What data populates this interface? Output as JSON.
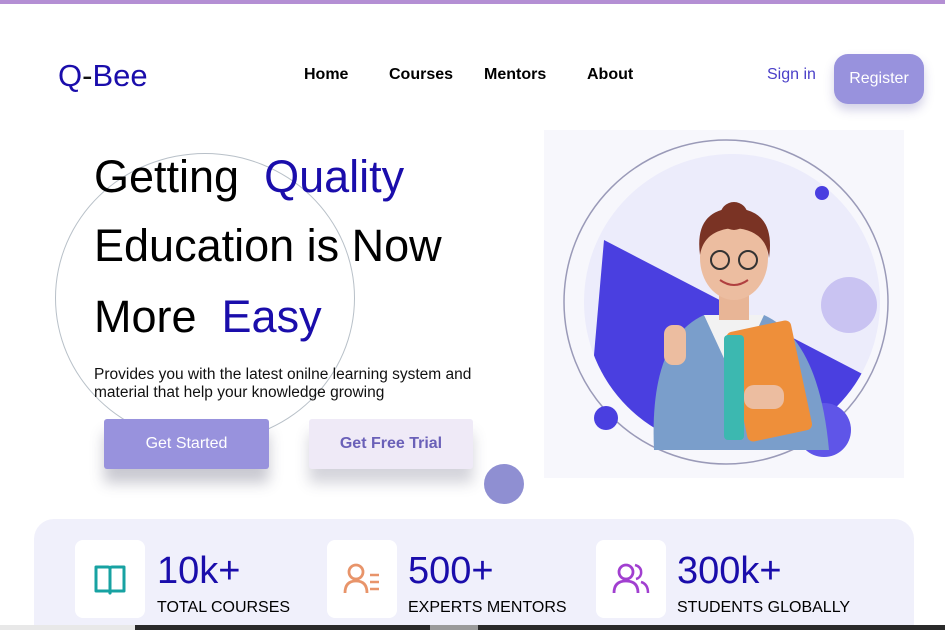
{
  "brand": {
    "name_prefix": "Q",
    "name_dash": "-",
    "name_suffix": "Bee"
  },
  "nav": {
    "home": "Home",
    "courses": "Courses",
    "mentors": "Mentors",
    "about": "About"
  },
  "auth": {
    "signin": "Sign in",
    "register": "Register"
  },
  "hero": {
    "line1_a": "Getting",
    "line1_b": "Quality",
    "line2": "Education is Now",
    "line3_a": "More",
    "line3_b": "Easy",
    "subtext": "Provides you with the latest onilne learning system and material that help your knowledge growing",
    "cta_primary": "Get Started",
    "cta_secondary": "Get Free Trial"
  },
  "stats": [
    {
      "icon": "book-icon",
      "value": "10k+",
      "label": "TOTAL COURSES",
      "color": "#17a2a2"
    },
    {
      "icon": "mentor-list-icon",
      "value": "500+",
      "label": "EXPERTS MENTORS",
      "color": "#e8946a"
    },
    {
      "icon": "users-icon",
      "value": "300k+",
      "label": "STUDENTS GLOBALLY",
      "color": "#a13fd0"
    }
  ],
  "colors": {
    "accent": "#1a0dab",
    "button": "#9892dd",
    "topbar": "#b48fd4",
    "hero_shape": "#4a3fe0"
  }
}
